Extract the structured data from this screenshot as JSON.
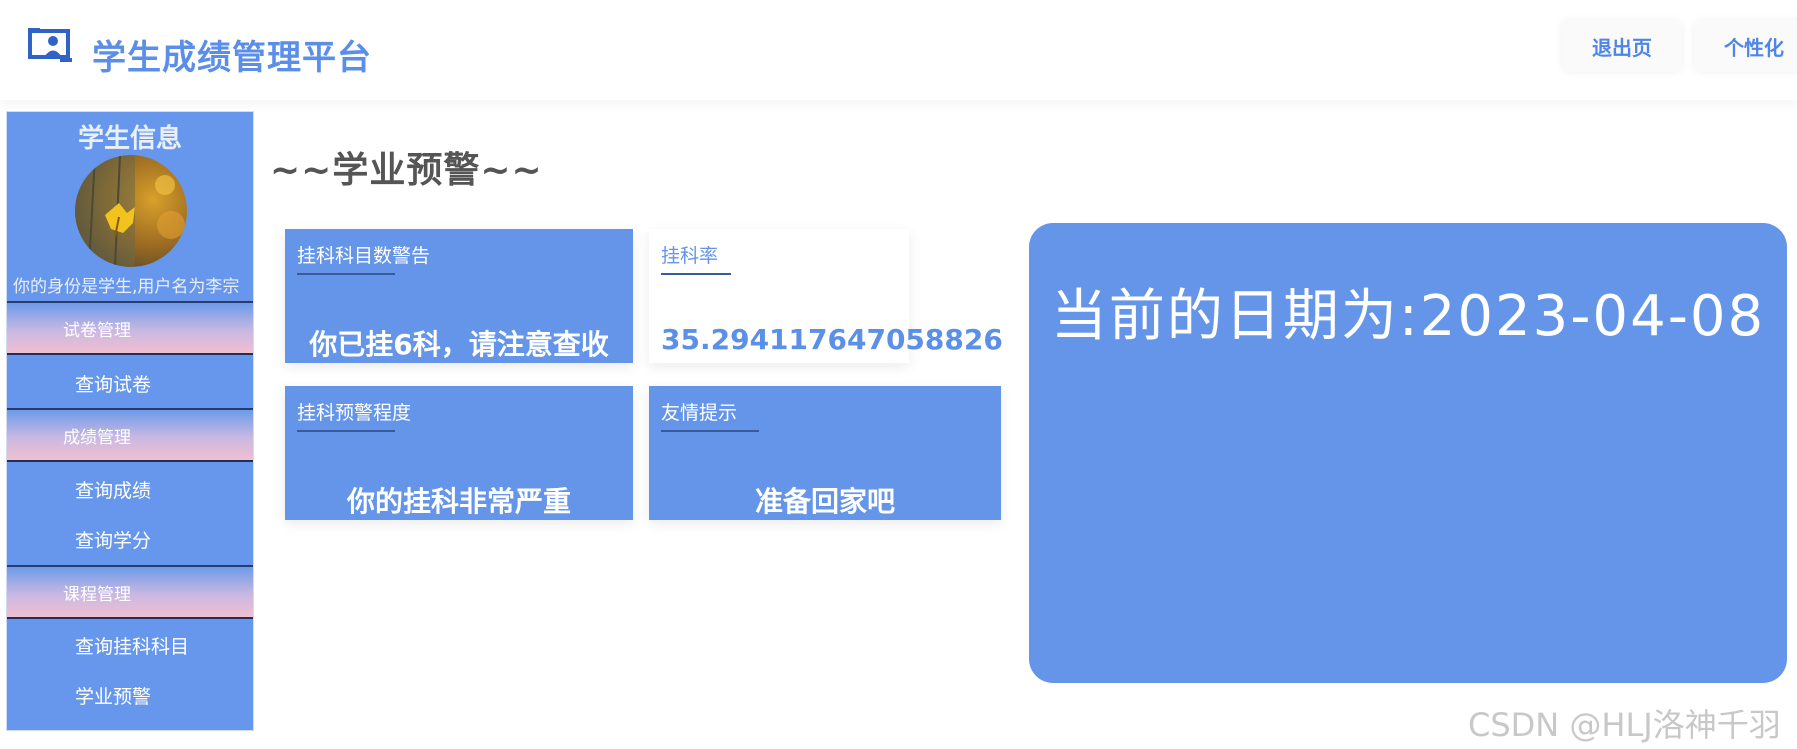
{
  "header": {
    "app_title": "学生成绩管理平台",
    "buttons": {
      "exit": "退出页",
      "customize": "个性化"
    }
  },
  "sidebar": {
    "title": "学生信息",
    "identity_text": "你的身份是学生,用户名为李宗",
    "groups": [
      {
        "label": "试卷管理",
        "items": [
          "查询试卷"
        ]
      },
      {
        "label": "成绩管理",
        "items": [
          "查询成绩",
          "查询学分"
        ]
      },
      {
        "label": "课程管理",
        "items": [
          "查询挂科科目",
          "学业预警"
        ]
      }
    ]
  },
  "main": {
    "section_title": "~~学业预警~~",
    "cards": [
      {
        "label": "挂科科目数警告",
        "value": "你已挂6科，请注意查收"
      },
      {
        "label": "挂科率",
        "value": "35.294117647058826"
      },
      {
        "label": "挂科预警程度",
        "value": "你的挂科非常严重"
      },
      {
        "label": "友情提示",
        "value": "准备回家吧"
      }
    ],
    "date_text": "当前的日期为:2023-04-08"
  },
  "watermark": "CSDN @HLJ洛神千羽",
  "colors": {
    "accent": "#6595e8",
    "title_blue": "#5a8ee8",
    "sidebar_bg": "#6797ec"
  },
  "icons": {
    "logo": "presentation-user-icon"
  }
}
